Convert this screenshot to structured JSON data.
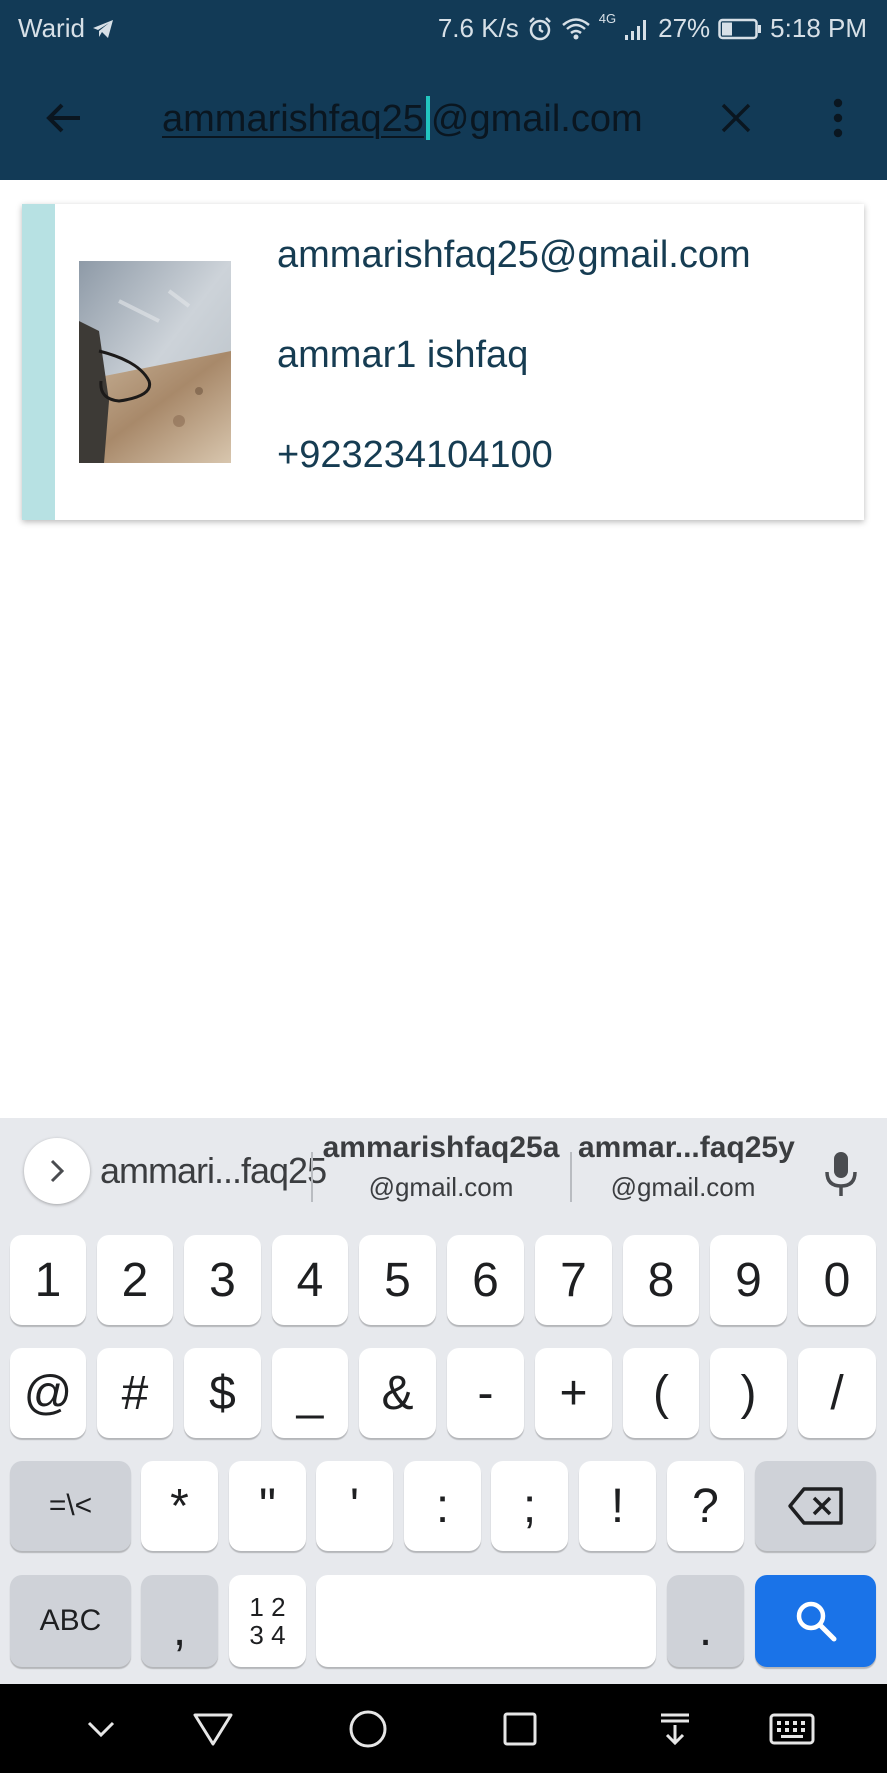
{
  "status_bar": {
    "carrier": "Warid",
    "speed": "7.6 K/s",
    "network": "4G",
    "battery": "27%",
    "time": "5:18 PM"
  },
  "search": {
    "typed": "ammarishfaq25",
    "completion": "@gmail.com"
  },
  "contact": {
    "email": "ammarishfaq25@gmail.com",
    "name": "ammar1 ishfaq",
    "phone": "+923234104100"
  },
  "suggestions": {
    "first": "ammari...faq25",
    "second_line1": "ammarishfaq25a",
    "second_line2": "@gmail.com",
    "third_line1": "ammar...faq25y",
    "third_line2": "@gmail.com"
  },
  "keyboard": {
    "row1": [
      "1",
      "2",
      "3",
      "4",
      "5",
      "6",
      "7",
      "8",
      "9",
      "0"
    ],
    "row2": [
      "@",
      "#",
      "$",
      "_",
      "&",
      "-",
      "+",
      "(",
      ")",
      "/"
    ],
    "row3": [
      "*",
      "\"",
      "'",
      ":",
      ";",
      "!",
      "?"
    ],
    "shift_label": "=\\<",
    "abc_label": "ABC",
    "comma_label": ",",
    "nums_line1": "1 2",
    "nums_line2": "3 4",
    "period_label": "."
  },
  "colors": {
    "app_bar": "#123a56",
    "accent": "#22c6c0",
    "card_stripe": "#b7e1e3",
    "search_key": "#1a73e8"
  }
}
